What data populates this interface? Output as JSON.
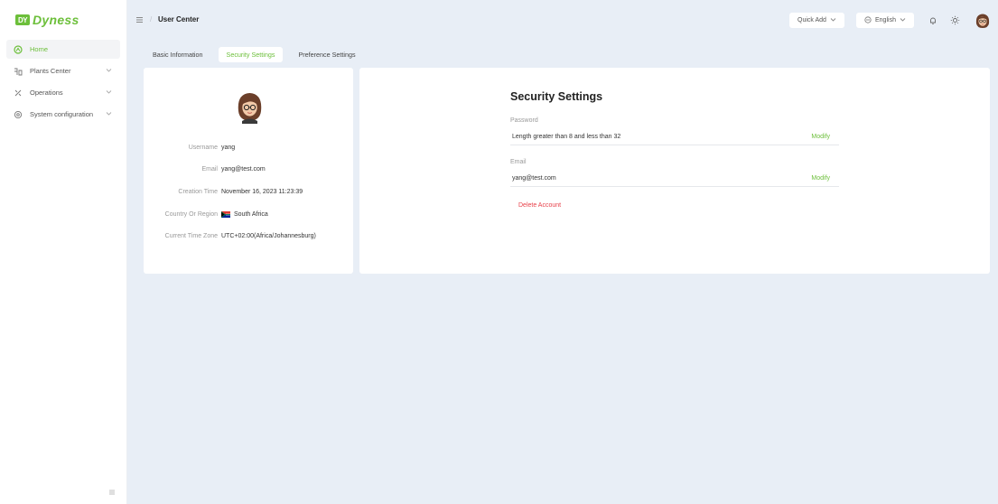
{
  "brand": {
    "logo_mark": "DY",
    "name": "Dyness",
    "color": "#6cbf3a"
  },
  "sidebar": {
    "items": [
      {
        "label": "Home",
        "icon": "home-icon",
        "active": true
      },
      {
        "label": "Plants Center",
        "icon": "plant-icon"
      },
      {
        "label": "Operations",
        "icon": "tools-icon"
      },
      {
        "label": "System configuration",
        "icon": "gear-icon"
      }
    ]
  },
  "header": {
    "breadcrumb_sep": "/",
    "title": "User Center",
    "quick_add": "Quick Add",
    "language": "English"
  },
  "tabs": [
    "Basic Information",
    "Security Settings",
    "Preference Settings"
  ],
  "profile": {
    "username_label": "Username",
    "username": "yang",
    "email_label": "Email",
    "email": "yang@test.com",
    "created_label": "Creation Time",
    "created": "November 16, 2023 11:23:39",
    "country_label": "Country Or Region",
    "country": "South Africa",
    "tz_label": "Current Time Zone",
    "tz": "UTC+02:00(Africa/Johannesburg)"
  },
  "security": {
    "title": "Security Settings",
    "password_label": "Password",
    "password_value": "Length greater than 8 and less than 32",
    "email_label": "Email",
    "email_value": "yang@test.com",
    "modify": "Modify",
    "delete": "Delete Account"
  }
}
